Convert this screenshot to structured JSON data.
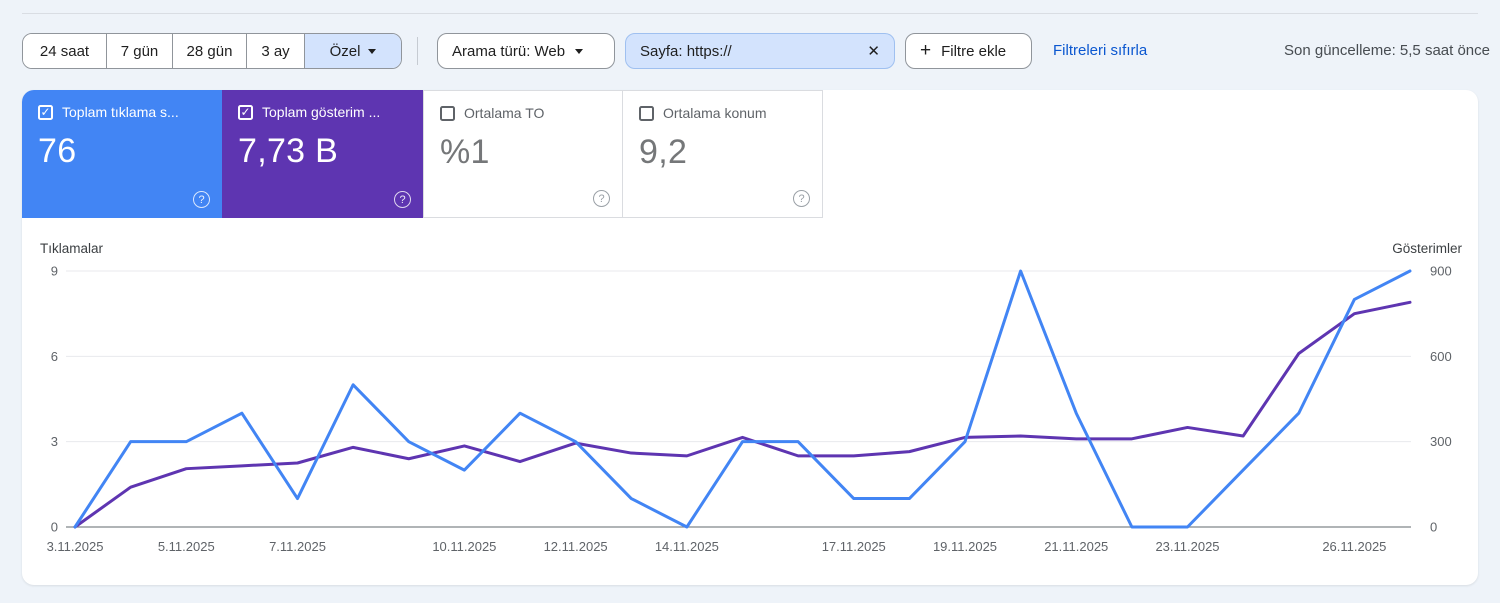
{
  "toolbar": {
    "date_ranges": [
      {
        "label": "24 saat",
        "selected": false
      },
      {
        "label": "7 gün",
        "selected": false
      },
      {
        "label": "28 gün",
        "selected": false
      },
      {
        "label": "3 ay",
        "selected": false
      },
      {
        "label": "Özel",
        "selected": true
      }
    ],
    "search_type_chip": "Arama türü: Web",
    "page_filter_chip": "Sayfa: https://",
    "add_filter_label": "Filtre ekle",
    "reset_filters_label": "Filtreleri sıfırla",
    "last_update": "Son güncelleme: 5,5 saat önce"
  },
  "metrics": [
    {
      "label": "Toplam tıklama s...",
      "value": "76",
      "checked": true,
      "color": "#4285f4"
    },
    {
      "label": "Toplam gösterim ...",
      "value": "7,73 B",
      "checked": true,
      "color": "#5e35b1"
    },
    {
      "label": "Ortalama TO",
      "value": "%1",
      "checked": false,
      "color": "#ffffff"
    },
    {
      "label": "Ortalama konum",
      "value": "9,2",
      "checked": false,
      "color": "#ffffff"
    }
  ],
  "chart_data": {
    "type": "line",
    "categories": [
      "3.11.2025",
      "4.11.2025",
      "5.11.2025",
      "6.11.2025",
      "7.11.2025",
      "8.11.2025",
      "9.11.2025",
      "10.11.2025",
      "11.11.2025",
      "12.11.2025",
      "13.11.2025",
      "14.11.2025",
      "15.11.2025",
      "16.11.2025",
      "17.11.2025",
      "18.11.2025",
      "19.11.2025",
      "20.11.2025",
      "21.11.2025",
      "22.11.2025",
      "23.11.2025",
      "24.11.2025",
      "25.11.2025",
      "26.11.2025",
      "27.11.2025"
    ],
    "xtick_indices": [
      0,
      2,
      4,
      7,
      9,
      11,
      14,
      16,
      18,
      20,
      23
    ],
    "series": [
      {
        "name": "Tıklamalar",
        "axis": "left",
        "color": "#4285f4",
        "values": [
          0,
          3,
          3,
          4,
          1,
          5,
          3,
          2,
          4,
          3,
          1,
          0,
          3,
          3,
          1,
          1,
          3,
          9,
          4,
          0,
          0,
          2,
          4,
          8,
          9
        ]
      },
      {
        "name": "Gösterimler",
        "axis": "right",
        "color": "#5e35b1",
        "values": [
          0,
          140,
          205,
          215,
          225,
          280,
          240,
          285,
          230,
          295,
          260,
          250,
          315,
          250,
          250,
          265,
          315,
          320,
          310,
          310,
          350,
          320,
          610,
          750,
          790
        ]
      }
    ],
    "left_axis": {
      "max": 9,
      "ticks": [
        0,
        3,
        6,
        9
      ]
    },
    "right_axis": {
      "max": 900,
      "ticks": [
        0,
        300,
        600,
        900
      ]
    },
    "grid": true,
    "legend_position": "axis-corners"
  }
}
